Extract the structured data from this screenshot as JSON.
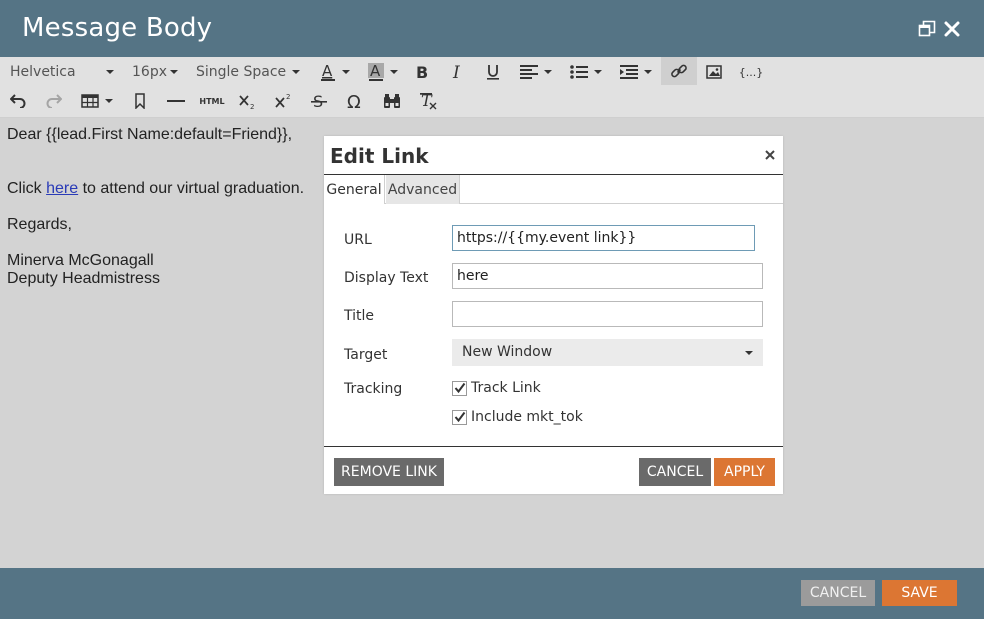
{
  "window": {
    "title": "Message Body",
    "restore_icon": "restore-window-icon",
    "close_icon": "close-icon"
  },
  "toolbar": {
    "font_family": "Helvetica",
    "font_size": "16px",
    "line_spacing": "Single Space",
    "html_label": "HTML",
    "merge_tag_label": "{...}",
    "active_tool": "insert-link",
    "icons": [
      "text-color-icon",
      "background-color-icon",
      "bold-icon",
      "italic-icon",
      "underline-icon",
      "align-icon",
      "bullet-list-icon",
      "indent-icon",
      "link-icon",
      "image-icon",
      "merge-tag-icon",
      "undo-icon",
      "redo-icon",
      "table-icon",
      "bookmark-icon",
      "horizontal-rule-icon",
      "html-icon",
      "subscript-icon",
      "superscript-icon",
      "strikethrough-icon",
      "special-character-icon",
      "find-icon",
      "clear-formatting-icon"
    ]
  },
  "editor": {
    "line1": "Dear {{lead.First Name:default=Friend}},",
    "line2_before": "Click ",
    "line2_link": "here",
    "line2_after": " to attend our virtual graduation.",
    "line3": "Regards,",
    "line4": "Minerva McGonagall",
    "line5": "Deputy Headmistress",
    "link_color": "#2a3bb7"
  },
  "dialog": {
    "title": "Edit Link",
    "tabs": [
      {
        "label": "General",
        "active": true
      },
      {
        "label": "Advanced",
        "active": false
      }
    ],
    "fields": {
      "url_label": "URL",
      "url_value": "https://{{my.event link}}",
      "display_text_label": "Display Text",
      "display_text_value": "here",
      "title_label": "Title",
      "title_value": "",
      "target_label": "Target",
      "target_value": "New Window",
      "tracking_label": "Tracking",
      "track_link_label": "Track Link",
      "track_link_checked": true,
      "include_mkt_tok_label": "Include mkt_tok",
      "include_mkt_tok_checked": true
    },
    "buttons": {
      "remove_link": "REMOVE LINK",
      "cancel": "CANCEL",
      "apply": "APPLY"
    }
  },
  "footer": {
    "cancel": "CANCEL",
    "save": "SAVE"
  },
  "colors": {
    "header_bg": "#557485",
    "accent_orange": "#dc7633",
    "dark_button": "#6a6a6a",
    "editor_bg": "#d3d3d3"
  }
}
